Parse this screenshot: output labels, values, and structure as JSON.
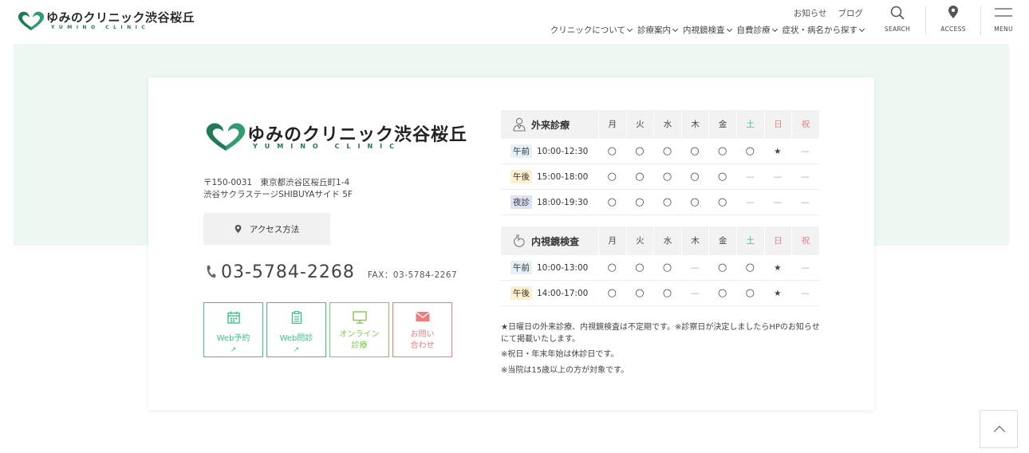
{
  "header": {
    "logo_name": "ゆみのクリニック渋谷桜丘",
    "logo_sub": "YUMINO CLINIC",
    "top_links": [
      "お知らせ",
      "ブログ"
    ],
    "main_nav": [
      "クリニックについて",
      "診療案内",
      "内視鏡検査",
      "自費診療",
      "症状・病名から探す"
    ],
    "search_label": "SEARCH",
    "access_label": "ACCESS",
    "menu_label": "MENU"
  },
  "card": {
    "logo_name": "ゆみのクリニック渋谷桜丘",
    "logo_sub": "YUMINO CLINIC",
    "address_line1": "〒150-0031　東京都渋谷区桜丘町1-4",
    "address_line2": "渋谷サクラステージSHIBUYAサイド 5F",
    "access_button": "アクセス方法",
    "tel": "03-5784-2268",
    "fax": "FAX：03-5784-2267",
    "buttons": [
      {
        "line1": "Web予約",
        "line2": "",
        "color": "#3fbf8a"
      },
      {
        "line1": "Web問診",
        "line2": "",
        "color": "#3fbf8a"
      },
      {
        "line1": "オンライン",
        "line2": "診療",
        "color": "#7fc94a"
      },
      {
        "line1": "お問い",
        "line2": "合わせ",
        "color": "#ef7d7d"
      }
    ]
  },
  "schedule": {
    "days": [
      "月",
      "火",
      "水",
      "木",
      "金",
      "土",
      "日",
      "祝"
    ],
    "day_colors": [
      "#444444",
      "#444444",
      "#444444",
      "#444444",
      "#444444",
      "#3fbf8a",
      "#ef7d7d",
      "#ef7d7d"
    ],
    "outpatient": {
      "title": "外来診療",
      "rows": [
        {
          "tag": "午前",
          "tag_color": "#e6f1f8",
          "time": "10:00-12:30",
          "marks": [
            "○",
            "○",
            "○",
            "○",
            "○",
            "○",
            "★",
            "—"
          ]
        },
        {
          "tag": "午後",
          "tag_color": "#fdf0cc",
          "time": "15:00-18:00",
          "marks": [
            "○",
            "○",
            "○",
            "○",
            "○",
            "—",
            "—",
            "—"
          ]
        },
        {
          "tag": "夜診",
          "tag_color": "#dfe1f5",
          "time": "18:00-19:30",
          "marks": [
            "○",
            "○",
            "○",
            "○",
            "○",
            "—",
            "—",
            "—"
          ]
        }
      ]
    },
    "endoscopy": {
      "title": "内視鏡検査",
      "rows": [
        {
          "tag": "午前",
          "tag_color": "#e6f1f8",
          "time": "10:00-13:00",
          "marks": [
            "○",
            "○",
            "○",
            "—",
            "○",
            "○",
            "★",
            "—"
          ]
        },
        {
          "tag": "午後",
          "tag_color": "#fdf0cc",
          "time": "14:00-17:00",
          "marks": [
            "○",
            "○",
            "○",
            "—",
            "○",
            "○",
            "★",
            "—"
          ]
        }
      ]
    },
    "notes": [
      "★日曜日の外来診療、内視鏡検査は不定期です。※診察日が決定しましたらHPのお知らせにて掲載いたします。",
      "※祝日・年末年始は休診日です。",
      "※当院は15歳以上の方が対象です。"
    ]
  },
  "colors": {
    "accent": "#1f7a55",
    "band": "#eef8f3"
  }
}
